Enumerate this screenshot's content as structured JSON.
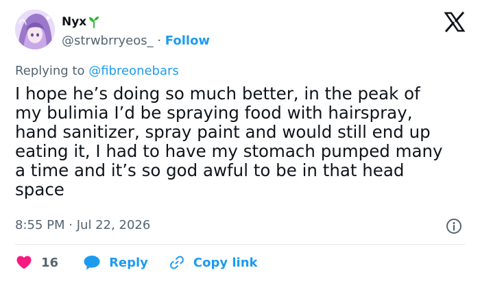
{
  "author": {
    "display_name": "Nyx",
    "handle": "@strwbrryeos_",
    "separator": "·",
    "follow_label": "Follow",
    "avatar_icon": "anime-avatar",
    "badge_icon": "sprout-icon"
  },
  "brand_icon": "x-logo-icon",
  "reply_context": {
    "prefix": "Replying to",
    "mention": "@fibreonebars"
  },
  "tweet": {
    "lines": [
      "I hope he’s doing so much better, in the peak of",
      "my bulimia I’d be spraying food with hairspray,",
      "hand sanitizer, spray paint and would still end up",
      "eating it, I had to have my stomach pumped many",
      "a time and it’s so god awful to be in that head",
      "space"
    ],
    "time": "8:55 PM",
    "separator": "·",
    "date": "Jul 22, 2026"
  },
  "actions": {
    "like_count": "16",
    "reply_label": "Reply",
    "copy_label": "Copy link"
  },
  "colors": {
    "accent": "#1d9bf0",
    "like": "#f91880",
    "muted": "#536471",
    "text": "#0f1419",
    "sprout": "#2eb82e"
  }
}
